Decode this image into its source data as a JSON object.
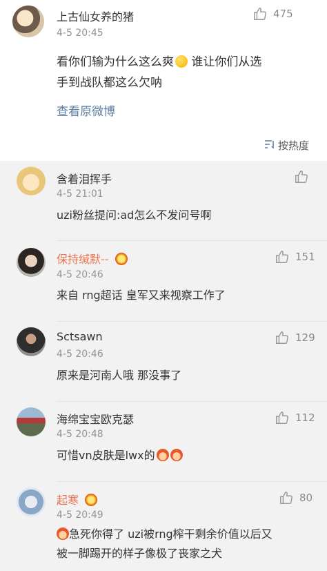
{
  "main_comment": {
    "username": "上古仙女养的猪",
    "time": "4-5 20:45",
    "likes": "475",
    "text_line1": "看你们输为什么这么爽",
    "text_line1_tail": " 谁让你们从选",
    "text_line2": "手到战队都这么欠呐",
    "view_original": "查看原微博",
    "sort_label": "按热度"
  },
  "replies": [
    {
      "username": "含着泪挥手",
      "time": "4-5 21:01",
      "likes": "",
      "text": "uzi粉丝提问:ad怎么不发问号啊",
      "vip": false
    },
    {
      "username": "保持缄默--",
      "time": "4-5 20:46",
      "likes": "151",
      "text": "来自 rng超话 皇军又来视察工作了",
      "vip": true
    },
    {
      "username": "Sctsawn",
      "time": "4-5 20:46",
      "likes": "129",
      "text": "原来是河南人哦 那没事了",
      "vip": false
    },
    {
      "username": "海绵宝宝欧克瑟",
      "time": "4-5 20:48",
      "likes": "112",
      "text": "可惜vn皮肤是lwx的",
      "vip": false
    },
    {
      "username": "起寒",
      "time": "4-5 20:49",
      "likes": "80",
      "text_line1": "急死你得了 uzi被rng榨干剩余价值以后又",
      "text_line2": "被一脚踢开的样子像极了丧家之犬",
      "vip": true
    }
  ]
}
